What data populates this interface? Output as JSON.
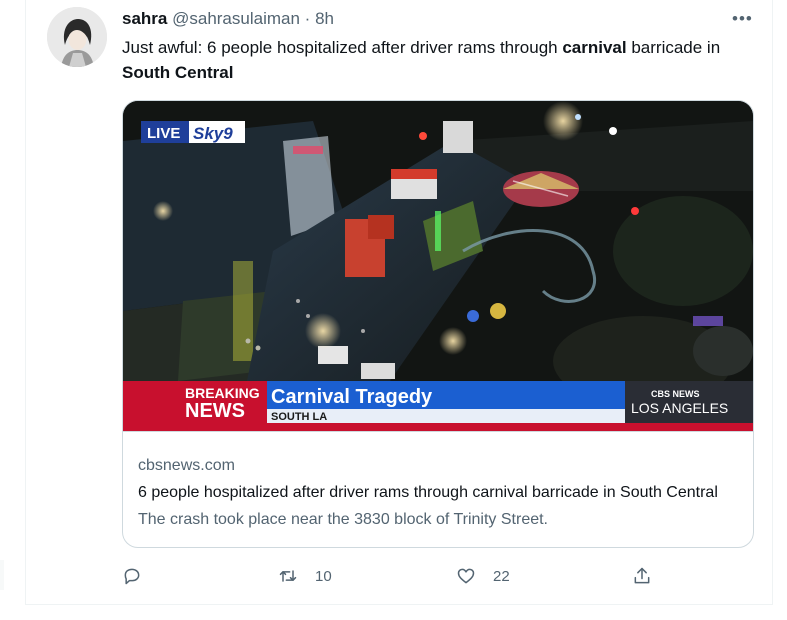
{
  "tweet": {
    "author_name": "sahra",
    "handle": "@sahrasulaiman",
    "separator": "·",
    "time": "8h",
    "text_parts": {
      "t1": "Just awful: 6 people hospitalized after driver rams through ",
      "b1": "carnival",
      "t2": " barricade in ",
      "b2": "South Central"
    },
    "more_label": "•••"
  },
  "card": {
    "image_overlay": {
      "live_label": "LIVE",
      "sky_label": "Sky9",
      "breaking_label": "BREAKING",
      "news_label": "NEWS",
      "headline": "Carnival Tragedy",
      "subline": "SOUTH LA",
      "network": "CBS NEWS",
      "city": "LOS ANGELES"
    },
    "domain": "cbsnews.com",
    "title": "6 people hospitalized after driver rams through carnival barricade in South Central",
    "description": "The crash took place near the 3830 block of Trinity Street."
  },
  "actions": {
    "replies": "",
    "retweets": "10",
    "likes": "22",
    "icons": [
      "reply-icon",
      "retweet-icon",
      "like-icon",
      "share-icon"
    ]
  },
  "colors": {
    "text": "#0f1419",
    "secondary": "#536471",
    "border": "#cfd9de",
    "breaking_red": "#c8102e",
    "banner_blue": "#1b5fd1"
  }
}
